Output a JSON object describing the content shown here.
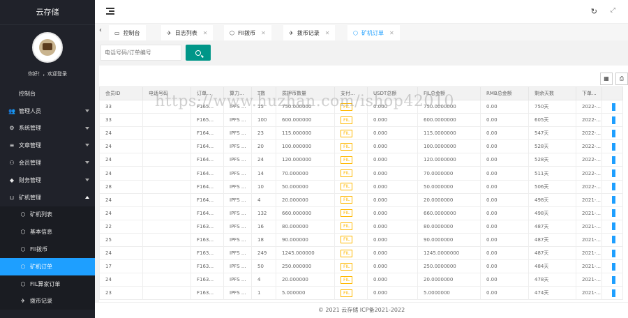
{
  "app": {
    "brand": "云存储",
    "greeting": "你好！，欢迎登录"
  },
  "sidebar": {
    "items": [
      {
        "label": "控制台",
        "icon": "none",
        "has_arrow": false,
        "level": "top"
      },
      {
        "label": "管理人员",
        "icon": "users-icon",
        "has_arrow": true
      },
      {
        "label": "系统管理",
        "icon": "gear-icon",
        "has_arrow": true
      },
      {
        "label": "文章管理",
        "icon": "layers-icon",
        "has_arrow": true
      },
      {
        "label": "会员管理",
        "icon": "user-icon",
        "has_arrow": true
      },
      {
        "label": "财务管理",
        "icon": "diamond-icon",
        "has_arrow": true
      },
      {
        "label": "矿机管理",
        "icon": "cart-icon",
        "has_arrow": true,
        "expanded": true
      }
    ],
    "sub_items": [
      {
        "label": "矿机列表",
        "icon": "cube-icon"
      },
      {
        "label": "基本信息",
        "icon": "cube-icon"
      },
      {
        "label": "FIl拨币",
        "icon": "cube-icon"
      },
      {
        "label": "矿机订单",
        "icon": "cube-icon",
        "active": true
      },
      {
        "label": "FIL算家订单",
        "icon": "cube-icon"
      },
      {
        "label": "拨币记录",
        "icon": "pin-icon"
      }
    ]
  },
  "header": {
    "refresh_icon": "refresh-icon",
    "fullscreen_icon": "fullscreen-icon"
  },
  "tabs": [
    {
      "label": "控制台",
      "icon": "monitor-icon",
      "closable": false
    },
    {
      "label": "日志列表",
      "icon": "pin-icon",
      "closable": true
    },
    {
      "label": "FIl拨币",
      "icon": "cube-icon",
      "closable": true
    },
    {
      "label": "拨币记录",
      "icon": "pin-icon",
      "closable": true
    },
    {
      "label": "矿机订单",
      "icon": "cube-icon",
      "closable": true,
      "active": true
    }
  ],
  "search": {
    "placeholder": "电话号码/订单编号"
  },
  "table": {
    "columns": [
      "会员ID",
      "电话号码",
      "订单...",
      "算力...",
      "T数",
      "质押币数量",
      "支付...",
      "USDT总额",
      "FIL总金额",
      "RMB总金额",
      "剩余天数",
      "下单..."
    ],
    "rows": [
      [
        "33",
        "",
        "F165...",
        "IPFS ...",
        "15",
        "750.000000",
        "FIL",
        "0.000",
        "750.0000000",
        "0.00",
        "750天",
        "2022-..."
      ],
      [
        "33",
        "",
        "F165...",
        "IPFS ...",
        "100",
        "600.000000",
        "FIL",
        "0.000",
        "600.0000000",
        "0.00",
        "605天",
        "2022-..."
      ],
      [
        "24",
        "",
        "F164...",
        "IPFS ...",
        "23",
        "115.000000",
        "FIL",
        "0.000",
        "115.0000000",
        "0.00",
        "547天",
        "2022-..."
      ],
      [
        "24",
        "",
        "F164...",
        "IPFS ...",
        "20",
        "100.000000",
        "FIL",
        "0.000",
        "100.0000000",
        "0.00",
        "528天",
        "2022-..."
      ],
      [
        "24",
        "",
        "F164...",
        "IPFS ...",
        "24",
        "120.000000",
        "FIL",
        "0.000",
        "120.0000000",
        "0.00",
        "528天",
        "2022-..."
      ],
      [
        "24",
        "",
        "F164...",
        "IPFS ...",
        "14",
        "70.000000",
        "FIL",
        "0.000",
        "70.0000000",
        "0.00",
        "511天",
        "2022-..."
      ],
      [
        "28",
        "",
        "F164...",
        "IPFS ...",
        "10",
        "50.000000",
        "FIL",
        "0.000",
        "50.0000000",
        "0.00",
        "506天",
        "2022-..."
      ],
      [
        "24",
        "",
        "F164...",
        "IPFS ...",
        "4",
        "20.000000",
        "FIL",
        "0.000",
        "20.0000000",
        "0.00",
        "498天",
        "2021-..."
      ],
      [
        "24",
        "",
        "F164...",
        "IPFS ...",
        "132",
        "660.000000",
        "FIL",
        "0.000",
        "660.0000000",
        "0.00",
        "498天",
        "2021-..."
      ],
      [
        "22",
        "",
        "F163...",
        "IPFS ...",
        "16",
        "80.000000",
        "FIL",
        "0.000",
        "80.0000000",
        "0.00",
        "487天",
        "2021-..."
      ],
      [
        "25",
        "",
        "F163...",
        "IPFS ...",
        "18",
        "90.000000",
        "FIL",
        "0.000",
        "90.0000000",
        "0.00",
        "487天",
        "2021-..."
      ],
      [
        "24",
        "",
        "F163...",
        "IPFS ...",
        "249",
        "1245.000000",
        "FIL",
        "0.000",
        "1245.0000000",
        "0.00",
        "487天",
        "2021-..."
      ],
      [
        "17",
        "",
        "F163...",
        "IPFS ...",
        "50",
        "250.000000",
        "FIL",
        "0.000",
        "250.0000000",
        "0.00",
        "484天",
        "2021-..."
      ],
      [
        "24",
        "",
        "F163...",
        "IPFS ...",
        "4",
        "20.000000",
        "FIL",
        "0.000",
        "20.0000000",
        "0.00",
        "478天",
        "2021-..."
      ],
      [
        "23",
        "",
        "F163...",
        "IPFS ...",
        "1",
        "5.000000",
        "FIL",
        "0.000",
        "5.0000000",
        "0.00",
        "474天",
        "2021-..."
      ]
    ]
  },
  "footer": {
    "text": "© 2021 云存储  ICP备2021-2022"
  },
  "watermark": {
    "text": "https://www.huzhan.com/ishop42010"
  },
  "colors": {
    "sidebar_bg": "#20222a",
    "active": "#1e9fff",
    "search_btn": "#009688",
    "fil_badge": "#ffb800"
  }
}
